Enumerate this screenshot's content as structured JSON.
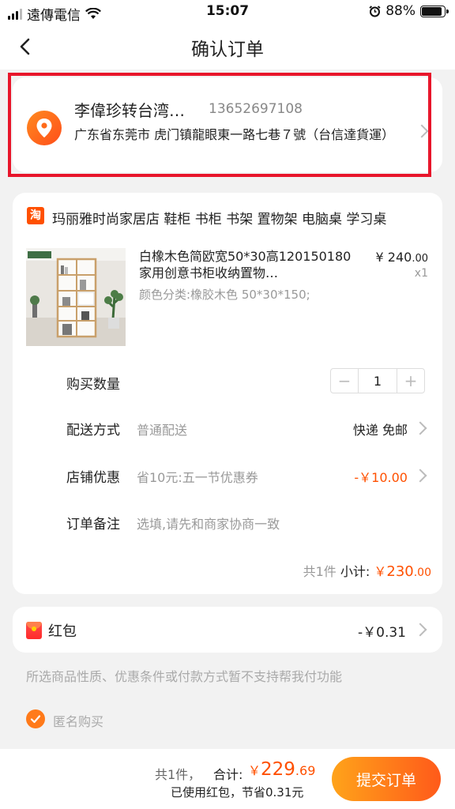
{
  "status_bar": {
    "carrier": "遠傳電信",
    "time": "15:07",
    "battery": "88%",
    "battery_level": 0.88
  },
  "nav": {
    "title": "确认订单"
  },
  "address": {
    "name": "李偉珍转台湾…",
    "phone": "13652697108",
    "detail": "广东省东莞市 虎门镇龍眼東一路七巷７號（台信達貨運）"
  },
  "order": {
    "shop_icon_char": "淘",
    "shop_name": "玛丽雅时尚家居店 鞋柜 书柜 书架 置物架 电脑桌 学习桌",
    "product": {
      "title": "白橡木色简欧宽50*30高120150180家用创意书柜收纳置物…",
      "spec": "颜色分类:橡胶木色 50*30*150;",
      "price_currency": "¥",
      "price_int": "240",
      "price_dec": ".00",
      "qty": "x1"
    },
    "quantity": {
      "label": "购买数量",
      "minus": "−",
      "value": "1",
      "plus": "+"
    },
    "delivery": {
      "label": "配送方式",
      "value": "普通配送",
      "right": "快递 免邮"
    },
    "coupon": {
      "label": "店铺优惠",
      "value": "省10元:五一节优惠券",
      "right": "-￥10.00"
    },
    "remark": {
      "label": "订单备注",
      "placeholder": "选填,请先和商家协商一致"
    },
    "subtotal": {
      "count": "共1件",
      "label": "小计:",
      "currency": "￥",
      "int": "230",
      "dec": ".00"
    }
  },
  "red_packet": {
    "label": "红包",
    "amount": "-￥0.31"
  },
  "notice": "所选商品性质、优惠条件或付款方式暂不支持帮我付功能",
  "anonymous": {
    "label": "匿名购买",
    "checked": true
  },
  "bottom": {
    "count": "共1件，",
    "total_label": "合计:",
    "currency": "￥",
    "total_int": "229",
    "total_dec": ".69",
    "saved": "已使用红包，节省0.31元",
    "submit": "提交订单"
  },
  "colors": {
    "accent": "#ff5000",
    "highlight_border": "#e8162b",
    "submit_gradient_start": "#ffa31a",
    "submit_gradient_end": "#ff5a1a"
  },
  "icons": [
    "signal-icon",
    "wifi-icon",
    "alarm-icon",
    "battery-icon",
    "back-arrow-icon",
    "location-pin-icon",
    "taobao-icon",
    "chevron-right-icon",
    "red-packet-icon",
    "checkmark-icon"
  ]
}
